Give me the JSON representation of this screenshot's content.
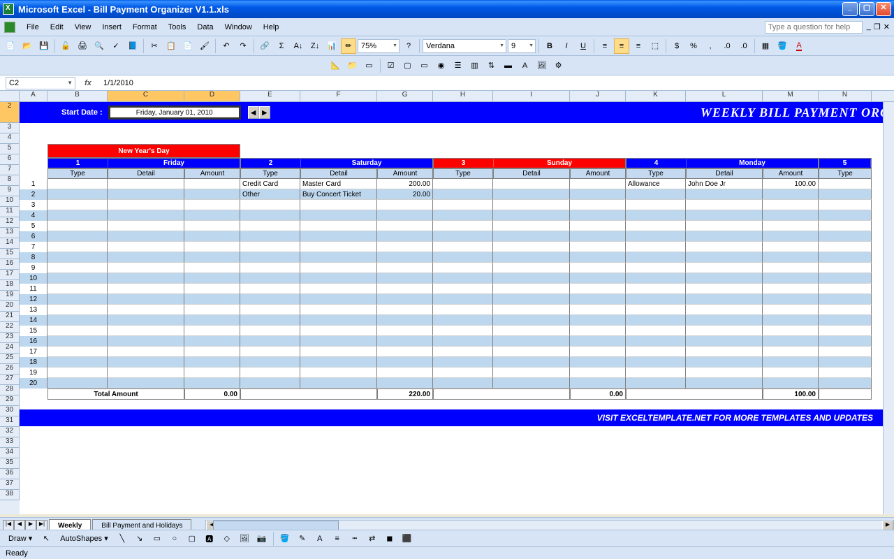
{
  "window": {
    "title": "Microsoft Excel - Bill Payment Organizer V1.1.xls"
  },
  "menu": {
    "items": [
      "File",
      "Edit",
      "View",
      "Insert",
      "Format",
      "Tools",
      "Data",
      "Window",
      "Help"
    ],
    "question_placeholder": "Type a question for help"
  },
  "toolbar": {
    "zoom": "75%",
    "font_name": "Verdana",
    "font_size": "9"
  },
  "formula": {
    "cell": "C2",
    "value": "1/1/2010"
  },
  "columns": [
    "A",
    "B",
    "C",
    "D",
    "E",
    "F",
    "G",
    "H",
    "I",
    "J",
    "K",
    "L",
    "M",
    "N"
  ],
  "sheet": {
    "start_date_label": "Start Date :",
    "start_date_value": "Friday, January 01, 2010",
    "banner_title": "WEEKLY BILL PAYMENT ORG",
    "holiday_label": "New Year's Day",
    "days": [
      {
        "num": "1",
        "name": "Friday"
      },
      {
        "num": "2",
        "name": "Saturday"
      },
      {
        "num": "3",
        "name": "Sunday"
      },
      {
        "num": "4",
        "name": "Monday"
      },
      {
        "num": "5",
        "name": ""
      }
    ],
    "subheaders": [
      "Type",
      "Detail",
      "Amount"
    ],
    "rows": [
      {
        "n": "1",
        "cells": [
          "",
          "",
          "",
          "Credit Card",
          "Master Card",
          "200.00",
          "",
          "",
          "",
          "Allowance",
          "John Doe Jr",
          "100.00",
          "",
          ""
        ]
      },
      {
        "n": "2",
        "cells": [
          "",
          "",
          "",
          "Other",
          "Buy Concert Ticket",
          "20.00",
          "",
          "",
          "",
          "",
          "",
          "",
          "",
          ""
        ]
      },
      {
        "n": "3",
        "cells": [
          "",
          "",
          "",
          "",
          "",
          "",
          "",
          "",
          "",
          "",
          "",
          "",
          "",
          ""
        ]
      },
      {
        "n": "4",
        "cells": [
          "",
          "",
          "",
          "",
          "",
          "",
          "",
          "",
          "",
          "",
          "",
          "",
          "",
          ""
        ]
      },
      {
        "n": "5",
        "cells": [
          "",
          "",
          "",
          "",
          "",
          "",
          "",
          "",
          "",
          "",
          "",
          "",
          "",
          ""
        ]
      },
      {
        "n": "6",
        "cells": [
          "",
          "",
          "",
          "",
          "",
          "",
          "",
          "",
          "",
          "",
          "",
          "",
          "",
          ""
        ]
      },
      {
        "n": "7",
        "cells": [
          "",
          "",
          "",
          "",
          "",
          "",
          "",
          "",
          "",
          "",
          "",
          "",
          "",
          ""
        ]
      },
      {
        "n": "8",
        "cells": [
          "",
          "",
          "",
          "",
          "",
          "",
          "",
          "",
          "",
          "",
          "",
          "",
          "",
          ""
        ]
      },
      {
        "n": "9",
        "cells": [
          "",
          "",
          "",
          "",
          "",
          "",
          "",
          "",
          "",
          "",
          "",
          "",
          "",
          ""
        ]
      },
      {
        "n": "10",
        "cells": [
          "",
          "",
          "",
          "",
          "",
          "",
          "",
          "",
          "",
          "",
          "",
          "",
          "",
          ""
        ]
      },
      {
        "n": "11",
        "cells": [
          "",
          "",
          "",
          "",
          "",
          "",
          "",
          "",
          "",
          "",
          "",
          "",
          "",
          ""
        ]
      },
      {
        "n": "12",
        "cells": [
          "",
          "",
          "",
          "",
          "",
          "",
          "",
          "",
          "",
          "",
          "",
          "",
          "",
          ""
        ]
      },
      {
        "n": "13",
        "cells": [
          "",
          "",
          "",
          "",
          "",
          "",
          "",
          "",
          "",
          "",
          "",
          "",
          "",
          ""
        ]
      },
      {
        "n": "14",
        "cells": [
          "",
          "",
          "",
          "",
          "",
          "",
          "",
          "",
          "",
          "",
          "",
          "",
          "",
          ""
        ]
      },
      {
        "n": "15",
        "cells": [
          "",
          "",
          "",
          "",
          "",
          "",
          "",
          "",
          "",
          "",
          "",
          "",
          "",
          ""
        ]
      },
      {
        "n": "16",
        "cells": [
          "",
          "",
          "",
          "",
          "",
          "",
          "",
          "",
          "",
          "",
          "",
          "",
          "",
          ""
        ]
      },
      {
        "n": "17",
        "cells": [
          "",
          "",
          "",
          "",
          "",
          "",
          "",
          "",
          "",
          "",
          "",
          "",
          "",
          ""
        ]
      },
      {
        "n": "18",
        "cells": [
          "",
          "",
          "",
          "",
          "",
          "",
          "",
          "",
          "",
          "",
          "",
          "",
          "",
          ""
        ]
      },
      {
        "n": "19",
        "cells": [
          "",
          "",
          "",
          "",
          "",
          "",
          "",
          "",
          "",
          "",
          "",
          "",
          "",
          ""
        ]
      },
      {
        "n": "20",
        "cells": [
          "",
          "",
          "",
          "",
          "",
          "",
          "",
          "",
          "",
          "",
          "",
          "",
          "",
          ""
        ]
      }
    ],
    "total_label": "Total Amount",
    "totals": [
      "0.00",
      "220.00",
      "0.00",
      "100.00"
    ],
    "footer_text": "VISIT EXCELTEMPLATE.NET FOR MORE TEMPLATES AND UPDATES"
  },
  "tabs": {
    "active": "Weekly",
    "inactive": "Bill Payment and Holidays"
  },
  "drawbar": {
    "draw": "Draw",
    "autoshapes": "AutoShapes"
  },
  "status": {
    "text": "Ready"
  },
  "colwidths": {
    "num": 40,
    "type": 86,
    "detail": 110,
    "amount": 80,
    "holiday": 276
  }
}
